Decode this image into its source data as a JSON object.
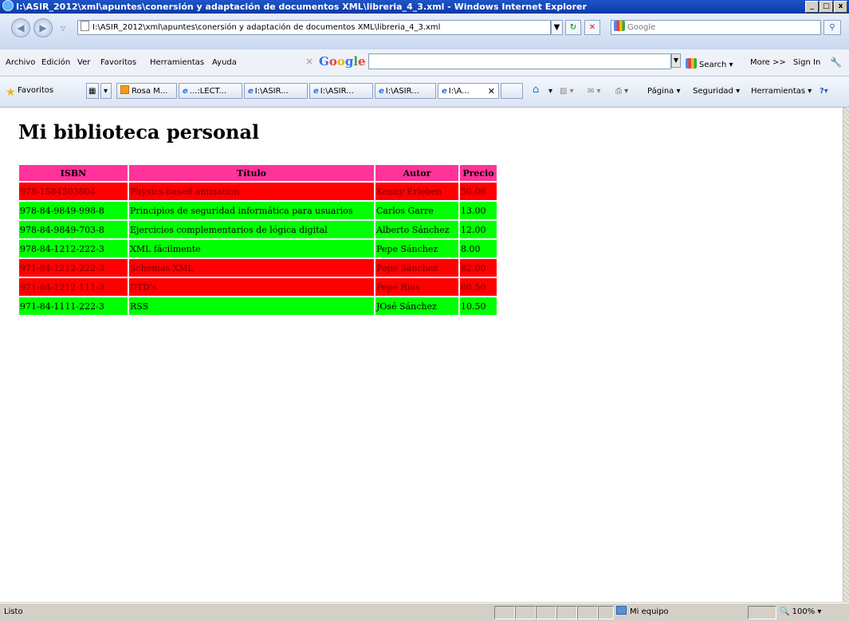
{
  "window": {
    "title": "I:\\ASIR_2012\\xml\\apuntes\\conersión y adaptación de documentos XML\\libreria_4_3.xml - Windows Internet Explorer",
    "buttons": {
      "minimize": "_",
      "maximize": "□",
      "close": "x"
    }
  },
  "addressbar": {
    "url": "I:\\ASIR_2012\\xml\\apuntes\\conersión y adaptación de documentos XML\\libreria_4_3.xml",
    "search_placeholder": "Google"
  },
  "menubar": {
    "items": [
      "Archivo",
      "Edición",
      "Ver",
      "Favoritos",
      "Herramientas",
      "Ayuda"
    ],
    "google_logo": [
      "G",
      "o",
      "o",
      "g",
      "l",
      "e"
    ],
    "search_label": "Search",
    "more_label": "More >>",
    "signin_label": "Sign In"
  },
  "favorites": {
    "label": "Favoritos",
    "tabs": [
      "Rosa M...",
      "...:LECT...",
      "I:\\ASIR...",
      "I:\\ASIR...",
      "I:\\ASIR...",
      "I:\\A..."
    ],
    "commands": [
      "Página",
      "Seguridad",
      "Herramientas"
    ]
  },
  "page": {
    "heading": "Mi biblioteca personal",
    "columns": [
      "ISBN",
      "Título",
      "Autor",
      "Precio"
    ],
    "rows": [
      {
        "isbn": "978-1584503804",
        "titulo": "Physics-based animation",
        "autor": "Kenny Erleben",
        "precio": "50.06",
        "status": "red"
      },
      {
        "isbn": "978-84-9849-998-8",
        "titulo": "Principios de seguridad informática para usuarios",
        "autor": "Carlos Garre",
        "precio": "13.00",
        "status": "green"
      },
      {
        "isbn": "978-84-9849-703-8",
        "titulo": "Ejercicios complementarios de lógica digital",
        "autor": "Alberto Sánchez",
        "precio": "12.00",
        "status": "green"
      },
      {
        "isbn": "978-84-1212-222-3",
        "titulo": "XML fácilmente",
        "autor": "Pepe Sánchez",
        "precio": "8.00",
        "status": "green"
      },
      {
        "isbn": "971-84-1212-222-3",
        "titulo": "Schemas XML",
        "autor": "Pepe Sánchez",
        "precio": "82.00",
        "status": "red"
      },
      {
        "isbn": "971-84-1212-111-3",
        "titulo": "DTD's",
        "autor": "Pepe Rios",
        "precio": "60.50",
        "status": "red"
      },
      {
        "isbn": "971-84-1111-222-3",
        "titulo": "RSS",
        "autor": "JOsé Sánchez",
        "precio": "10.50",
        "status": "green"
      }
    ]
  },
  "statusbar": {
    "status": "Listo",
    "zone": "Mi equipo",
    "zoom": "100%"
  }
}
